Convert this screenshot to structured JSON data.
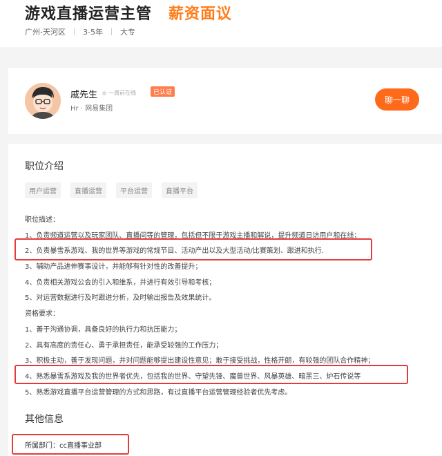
{
  "header": {
    "job_title": "游戏直播运营主管",
    "salary": "薪资面议",
    "location": "广州-天河区",
    "experience": "3-5年",
    "education": "大专"
  },
  "hr": {
    "name": "戚先生",
    "online_status": "一周前在线",
    "verified_label": "已认证",
    "company": "Hr · 网易集团",
    "chat_button": "聊一聊"
  },
  "job": {
    "section_title": "职位介绍",
    "tags": [
      "用户运营",
      "直播运营",
      "平台运营",
      "直播平台"
    ],
    "lines": [
      "职位描述：",
      "1、负责频道运营以及玩家团队、直播间等的管理，包括但不限于游戏主播和解说，提升频道日访用户和在线；",
      "2、负责暴雪系游戏、我的世界等游戏的常规节目、活动产出以及大型活动/比赛策划、跟进和执行.",
      "3、辅助产品进伸赛事设计，并能够有针对性的改善提升；",
      "4、负责相关游戏公会的引入和维系，并进行有效引导和考核；",
      "5、对运营数据进行及时跟进分析，及时输出报告及效果统计。",
      "资格要求：",
      "1、善于沟通协调，具备良好的执行力和抗压能力；",
      "2、具有高度的责任心、勇于承担责任，能承受较强的工作压力；",
      "3、积极主动，善于发现问题，并对问题能够提出建设性意见；敢于接受挑战，性格开朗，有较强的团队合作精神；",
      "4、熟悉暴雪系游戏及我的世界者优先，包括我的世界、守望先锋、魔兽世界、风暴英雄、暗黑三、炉石传说等",
      "5、熟悉游戏直播平台运营管理的方式和思路，有过直播平台运营管理经验者优先考虑。"
    ]
  },
  "other": {
    "section_title": "其他信息",
    "department": "所属部门：cc直播事业部"
  },
  "colors": {
    "accent": "#ff7d1a",
    "button": "#ff6a1a",
    "highlight_box": "#e53a3a"
  }
}
